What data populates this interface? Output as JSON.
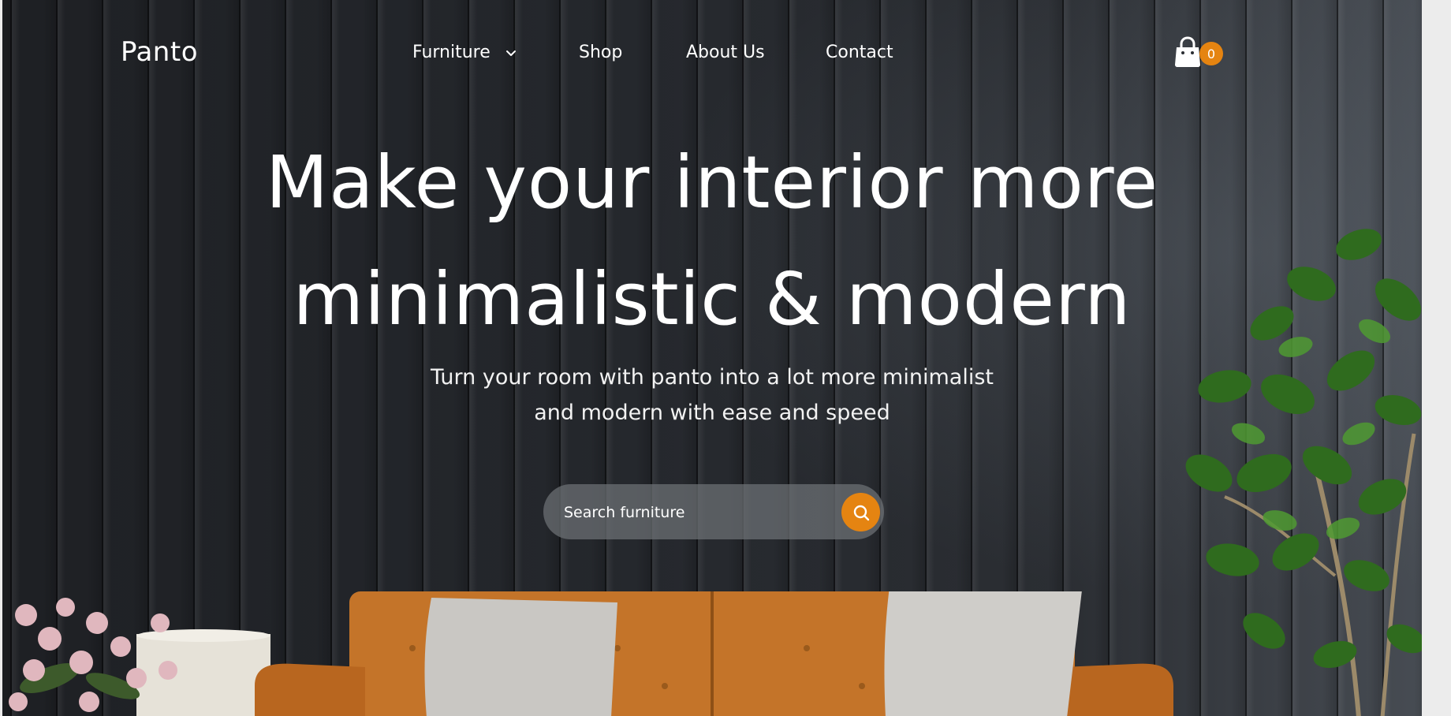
{
  "header": {
    "logo": "Panto",
    "nav": [
      {
        "label": "Furniture",
        "has_dropdown": true
      },
      {
        "label": "Shop"
      },
      {
        "label": "About Us"
      },
      {
        "label": "Contact"
      }
    ],
    "cart": {
      "count": "0",
      "icon": "shopping-bag-icon"
    }
  },
  "hero": {
    "headline_line1": "Make your interior more",
    "headline_line2": "minimalistic & modern",
    "subtitle_line1": "Turn your room with panto into a lot more minimalist",
    "subtitle_line2": "and modern with ease and speed",
    "search": {
      "placeholder": "Search furniture",
      "value": "",
      "icon": "search-icon"
    }
  },
  "colors": {
    "accent": "#e58411",
    "background": "#23262b",
    "text": "#ffffff"
  }
}
